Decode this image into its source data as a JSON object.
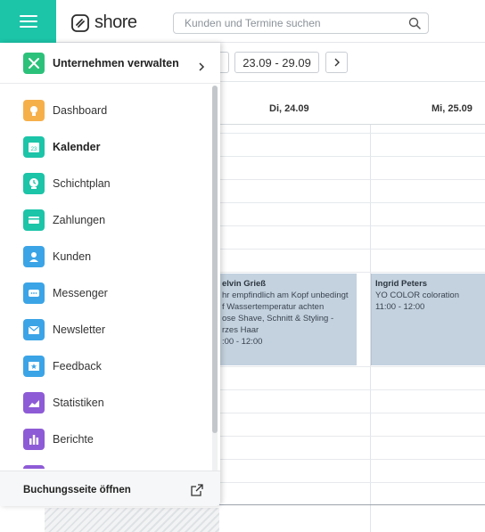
{
  "app": {
    "logo_text": "shore"
  },
  "search": {
    "placeholder": "Kunden und Termine suchen"
  },
  "calendar": {
    "date_range": "23.09 - 29.09",
    "days": [
      "Di, 24.09",
      "Mi, 25.09"
    ],
    "appointments": [
      {
        "name": "elvin Grieß",
        "lines": [
          "hr empfindlich am Kopf unbedingt",
          "f Wassertemperatur achten",
          "ose Shave, Schnitt & Styling -",
          "rzes Haar",
          ":00 - 12:00"
        ]
      },
      {
        "name": "Ingrid Peters",
        "lines": [
          "YO COLOR coloration",
          "11:00 - 12:00"
        ]
      }
    ]
  },
  "sidebar": {
    "company_label": "Unternehmen verwalten",
    "items": [
      {
        "label": "Dashboard",
        "icon": "lightbulb-icon",
        "color": "#f6b04a"
      },
      {
        "label": "Kalender",
        "icon": "calendar-icon",
        "color": "#1cc4a8",
        "day": "23",
        "active": true
      },
      {
        "label": "Schichtplan",
        "icon": "clock-icon",
        "color": "#1cc4a8"
      },
      {
        "label": "Zahlungen",
        "icon": "card-icon",
        "color": "#1cc4a8"
      },
      {
        "label": "Kunden",
        "icon": "customer-icon",
        "color": "#3ba4e6"
      },
      {
        "label": "Messenger",
        "icon": "chat-icon",
        "color": "#3ba4e6"
      },
      {
        "label": "Newsletter",
        "icon": "envelope-icon",
        "color": "#3ba4e6"
      },
      {
        "label": "Feedback",
        "icon": "star-icon",
        "color": "#3ba4e6"
      },
      {
        "label": "Statistiken",
        "icon": "chart-icon",
        "color": "#8e5bd6"
      },
      {
        "label": "Berichte",
        "icon": "report-icon",
        "color": "#8e5bd6"
      }
    ],
    "booking_label": "Buchungsseite öffnen"
  },
  "colors": {
    "accent": "#1cc4a8",
    "appointment": "#c4d2df"
  }
}
